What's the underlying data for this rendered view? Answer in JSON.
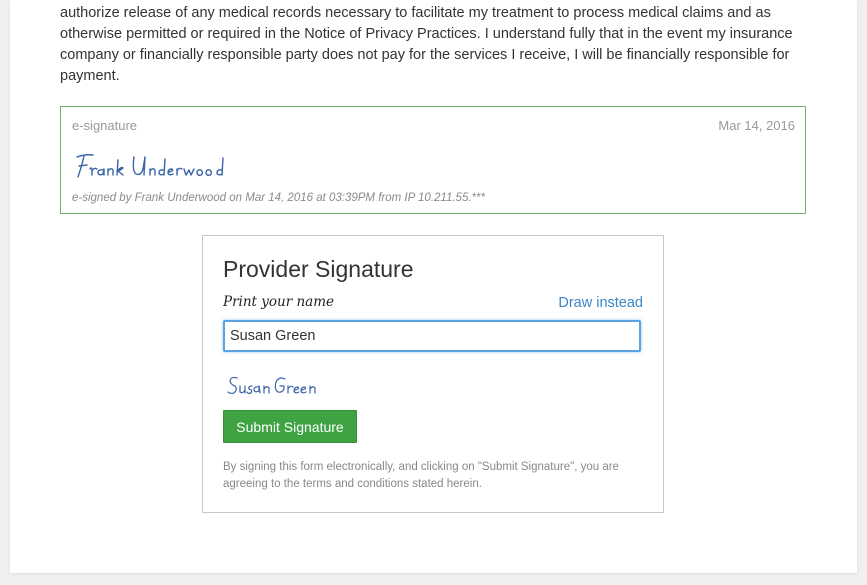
{
  "consent_text": "authorize release of any medical records necessary to facilitate my treatment to process medical claims and as otherwise permitted or required in the Notice of Privacy Practices. I understand fully that in the event my insurance company or financially responsible party does not pay for the services I receive, I will be financially responsible for payment.",
  "esignature": {
    "label": "e-signature",
    "date": "Mar 14, 2016",
    "signature_name": "Frank Underwood",
    "note": "e-signed by Frank Underwood on Mar 14, 2016 at 03:39PM from IP 10.211.55.***"
  },
  "provider_signature": {
    "title": "Provider Signature",
    "print_label": "Print your name",
    "draw_link": "Draw instead",
    "input_value": "Susan Green",
    "preview_name": "Susan Green",
    "submit_label": "Submit Signature",
    "disclaimer": "By signing this form electronically, and clicking on \"Submit Signature\", you are agreeing to the terms and conditions stated herein."
  },
  "colors": {
    "signature_ink": "#3a63a8",
    "accent_green": "#3fa343",
    "link_blue": "#3a87c8",
    "esig_border": "#6db56d"
  }
}
